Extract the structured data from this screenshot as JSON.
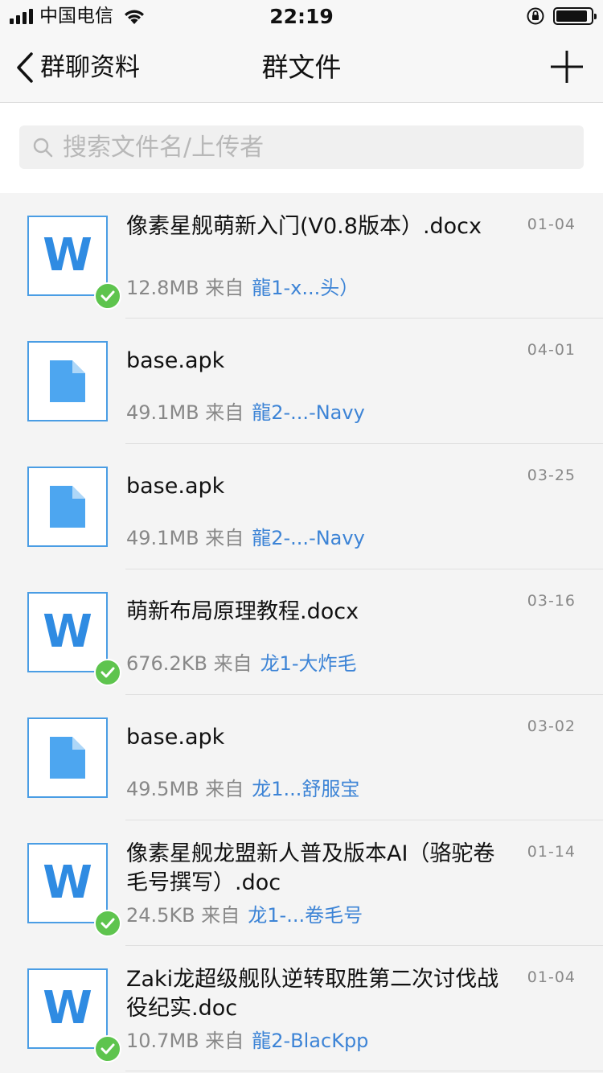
{
  "status_bar": {
    "carrier": "中国电信",
    "time": "22:19"
  },
  "nav": {
    "back_label": "群聊资料",
    "title": "群文件"
  },
  "search": {
    "placeholder": "搜索文件名/上传者"
  },
  "colors": {
    "accent": "#3d84d6",
    "word_blue": "#2f8be2",
    "check_green": "#5ec44e"
  },
  "files": [
    {
      "name": "像素星舰萌新入门(V0.8版本）.docx",
      "size": "12.8MB",
      "from_label": "来自",
      "uploader": "龍1-x...头）",
      "date": "01-04",
      "icon": "word-doc-icon",
      "downloaded": true
    },
    {
      "name": "base.apk",
      "size": "49.1MB",
      "from_label": "来自",
      "uploader": "龍2-...-Navy",
      "date": "04-01",
      "icon": "file-icon",
      "downloaded": false
    },
    {
      "name": "base.apk",
      "size": "49.1MB",
      "from_label": "来自",
      "uploader": "龍2-...-Navy",
      "date": "03-25",
      "icon": "file-icon",
      "downloaded": false
    },
    {
      "name": "萌新布局原理教程.docx",
      "size": "676.2KB",
      "from_label": "来自",
      "uploader": "龙1-大炸毛",
      "date": "03-16",
      "icon": "word-doc-icon",
      "downloaded": true
    },
    {
      "name": "base.apk",
      "size": "49.5MB",
      "from_label": "来自",
      "uploader": "龙1...舒服宝",
      "date": "03-02",
      "icon": "file-icon",
      "downloaded": false
    },
    {
      "name": "像素星舰龙盟新人普及版本AI（骆驼卷毛号撰写）.doc",
      "size": "24.5KB",
      "from_label": "来自",
      "uploader": "龙1-...卷毛号",
      "date": "01-14",
      "icon": "word-doc-icon",
      "downloaded": true
    },
    {
      "name": "Zaki龙超级舰队逆转取胜第二次讨伐战役纪实.doc",
      "size": "10.7MB",
      "from_label": "来自",
      "uploader": "龍2-BlacKpp",
      "date": "01-04",
      "icon": "word-doc-icon",
      "downloaded": true
    }
  ]
}
